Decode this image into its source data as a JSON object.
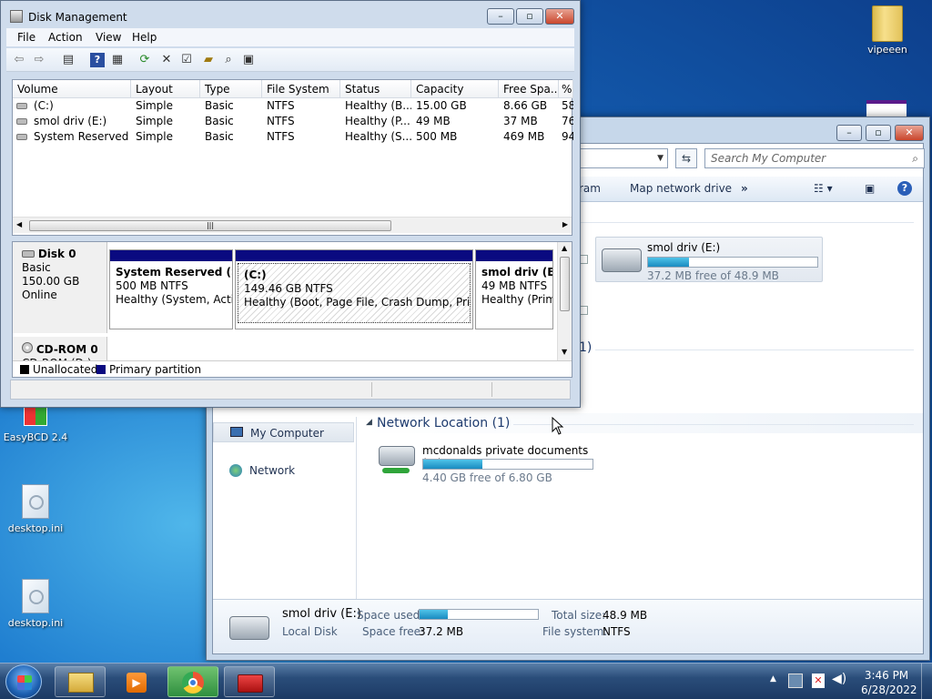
{
  "desktop": {
    "icons": [
      {
        "label": "vipeeen"
      },
      {
        "label": "EasyBCD 2.4"
      },
      {
        "label": "desktop.ini"
      },
      {
        "label": "desktop.ini"
      }
    ]
  },
  "explorer": {
    "search_placeholder": "Search My Computer",
    "commands": {
      "program_partial": "ram",
      "map_network": "Map network drive",
      "more": "»"
    },
    "group_partial": "1)",
    "drive_e": {
      "name": "smol driv (E:)",
      "free_text": "37.2 MB free of 48.9 MB",
      "used_fraction": 0.24
    },
    "network_location": {
      "header": "Network Location (1)"
    },
    "drive_z": {
      "name": "mcdonalds private documents (Z:)",
      "free_text": "4.40 GB free of 6.80 GB",
      "used_fraction": 0.35
    },
    "nav": {
      "my_computer": "My Computer",
      "network": "Network"
    },
    "details": {
      "name": "smol driv (E:)",
      "type": "Local Disk",
      "space_used_label": "Space used:",
      "space_used_fraction": 0.24,
      "space_free_label": "Space free:",
      "space_free_value": "37.2 MB",
      "total_size_label": "Total size:",
      "total_size_value": "48.9 MB",
      "file_system_label": "File system:",
      "file_system_value": "NTFS"
    }
  },
  "disk_mgmt": {
    "title": "Disk Management",
    "menu": [
      "File",
      "Action",
      "View",
      "Help"
    ],
    "columns": [
      "Volume",
      "Layout",
      "Type",
      "File System",
      "Status",
      "Capacity",
      "Free Spa...",
      "%"
    ],
    "rows": [
      [
        "(C:)",
        "Simple",
        "Basic",
        "NTFS",
        "Healthy (B...",
        "15.00 GB",
        "8.66 GB",
        "58"
      ],
      [
        "smol driv (E:)",
        "Simple",
        "Basic",
        "NTFS",
        "Healthy (P...",
        "49 MB",
        "37 MB",
        "76"
      ],
      [
        "System Reserved (...",
        "Simple",
        "Basic",
        "NTFS",
        "Healthy (S...",
        "500 MB",
        "469 MB",
        "94"
      ]
    ],
    "disk0": {
      "name": "Disk 0",
      "type": "Basic",
      "size": "150.00 GB",
      "state": "Online",
      "partitions": [
        {
          "name": "System Reserved  (S:)",
          "size": "500 MB NTFS",
          "status": "Healthy (System, Active"
        },
        {
          "name": "(C:)",
          "size": "149.46 GB NTFS",
          "status": "Healthy (Boot, Page File, Crash Dump, Primary"
        },
        {
          "name": "smol driv  (E:)",
          "size": "49 MB NTFS",
          "status": "Healthy (Prim"
        }
      ]
    },
    "cdrom": {
      "name": "CD-ROM 0",
      "sub": "CD-ROM (D:)"
    },
    "legend": {
      "unallocated": "Unallocated",
      "primary": "Primary partition"
    }
  },
  "taskbar": {
    "time": "3:46 PM",
    "date": "6/28/2022"
  }
}
